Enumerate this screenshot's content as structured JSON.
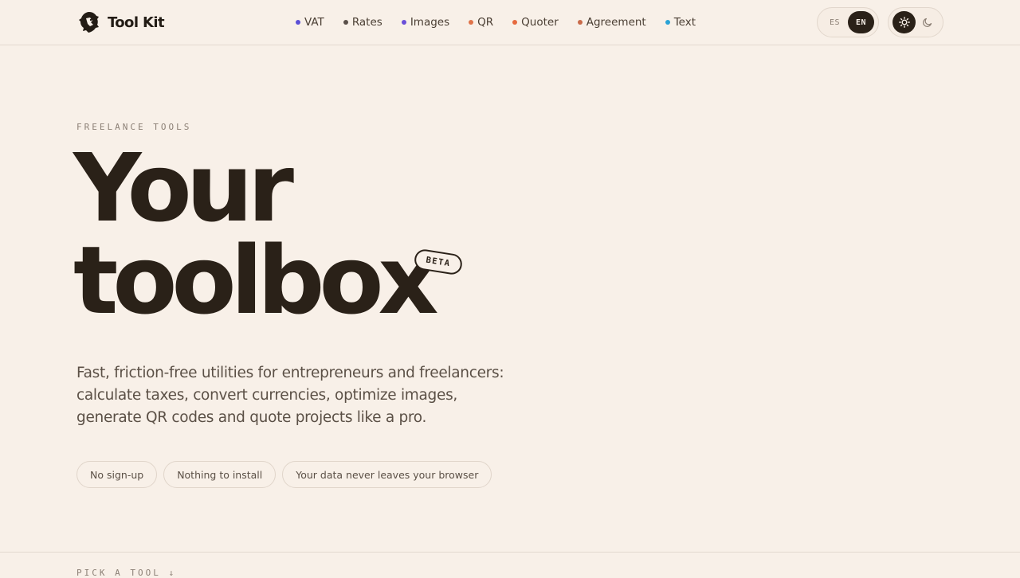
{
  "brand": {
    "name": "Tool Kit",
    "logo_icon": "lion-head-icon"
  },
  "nav": {
    "items": [
      {
        "label": "VAT",
        "dot_color": "#5b4fd6"
      },
      {
        "label": "Rates",
        "dot_color": "#5a504a"
      },
      {
        "label": "Images",
        "dot_color": "#6a4fd8"
      },
      {
        "label": "QR",
        "dot_color": "#e0744a"
      },
      {
        "label": "Quoter",
        "dot_color": "#e66a3f"
      },
      {
        "label": "Agreement",
        "dot_color": "#c96b4a"
      },
      {
        "label": "Text",
        "dot_color": "#2aa3d6"
      }
    ]
  },
  "language": {
    "options": [
      "ES",
      "EN"
    ],
    "selected": "EN"
  },
  "theme": {
    "options": [
      "sun-icon",
      "moon-icon"
    ],
    "selected": "light"
  },
  "hero": {
    "eyebrow": "FREELANCE TOOLS",
    "title_line1": "Your",
    "title_line2": "toolbox",
    "badge": "BETA",
    "description": "Fast, friction-free utilities for entrepreneurs and freelancers: calculate taxes, convert currencies, optimize images, generate QR codes and quote projects like a pro.",
    "chips": [
      "No sign-up",
      "Nothing to install",
      "Your data never leaves your browser"
    ]
  },
  "section": {
    "eyebrow": "PICK A TOOL ↓"
  },
  "colors": {
    "background": "#f8f0e8",
    "ink": "#2a2118",
    "muted": "#5b5046"
  }
}
